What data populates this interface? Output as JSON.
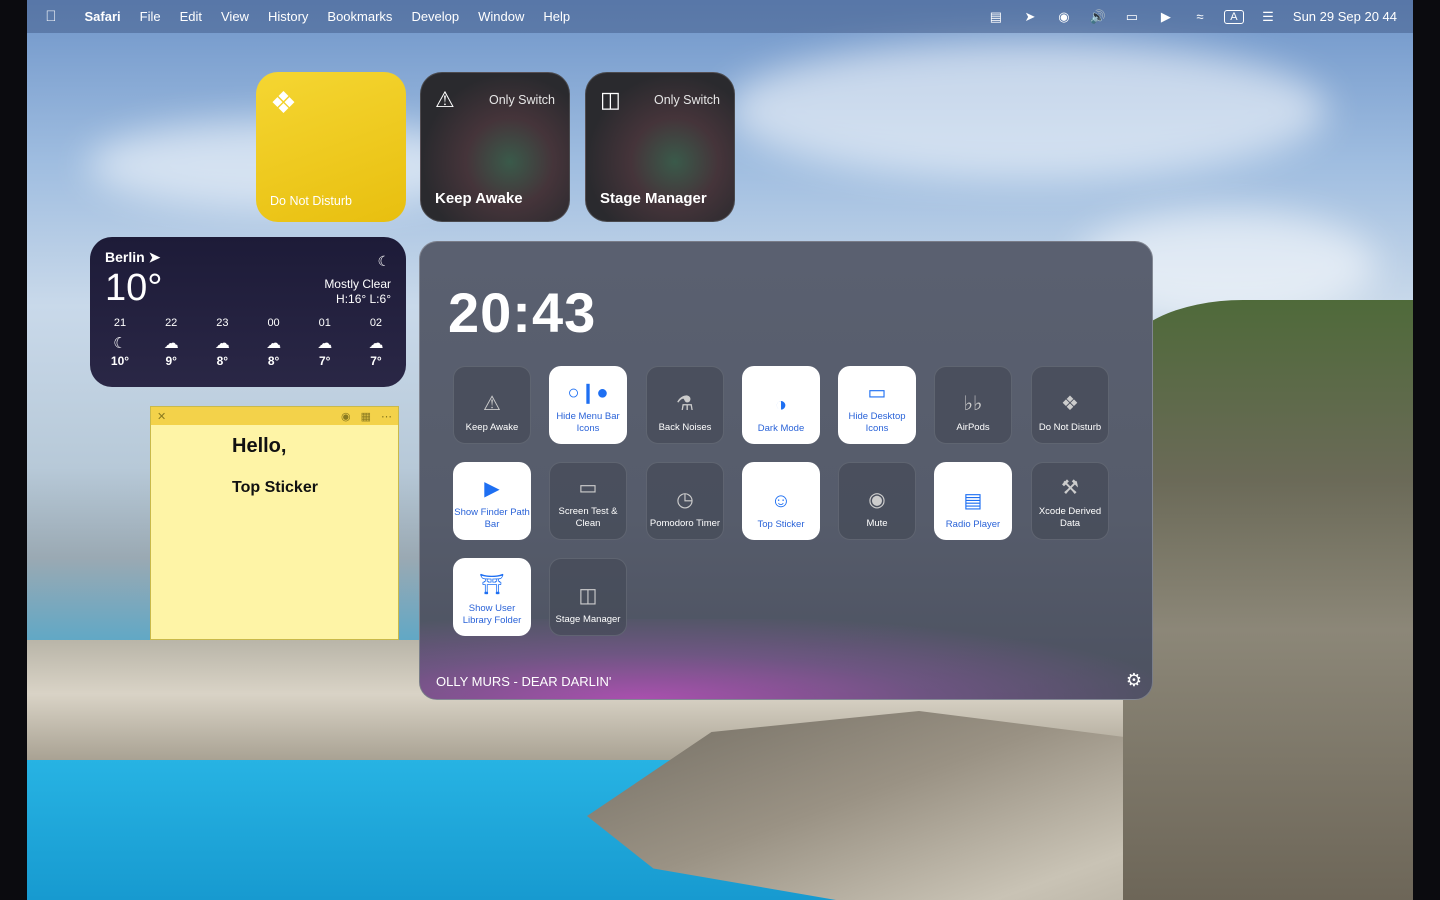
{
  "menubar": {
    "apple_icon": "apple-icon",
    "items": [
      "Safari",
      "File",
      "Edit",
      "View",
      "History",
      "Bookmarks",
      "Develop",
      "Window",
      "Help"
    ],
    "status_icons": [
      "control-strip-icon",
      "telegram-icon",
      "wechat-icon",
      "volume-icon",
      "battery-icon",
      "play-icon",
      "wifi-icon",
      "input-source-icon",
      "control-center-icon"
    ],
    "input_source": "A",
    "clock": "Sun 29 Sep  20 44"
  },
  "shortcuts": [
    {
      "label": "Do Not Disturb",
      "sub": "",
      "icon": "shortcuts-icon",
      "style": "yellow"
    },
    {
      "label": "Keep Awake",
      "sub": "Only Switch",
      "icon": "bell-slash-icon",
      "style": "dark"
    },
    {
      "label": "Stage Manager",
      "sub": "Only Switch",
      "icon": "stage-manager-icon",
      "style": "dark"
    }
  ],
  "weather": {
    "city": "Berlin",
    "temp": "10°",
    "condition": "Mostly Clear",
    "hilo": "H:16° L:6°",
    "hours": [
      {
        "time": "21",
        "icon": "moon-icon",
        "temp": "10°"
      },
      {
        "time": "22",
        "icon": "cloud-moon-icon",
        "temp": "9°"
      },
      {
        "time": "23",
        "icon": "cloud-moon-icon",
        "temp": "8°"
      },
      {
        "time": "00",
        "icon": "cloud-icon",
        "temp": "8°"
      },
      {
        "time": "01",
        "icon": "cloud-icon",
        "temp": "7°"
      },
      {
        "time": "02",
        "icon": "cloud-icon",
        "temp": "7°"
      }
    ]
  },
  "sticky": {
    "hello": "Hello,",
    "name": "Top Sticker"
  },
  "panel": {
    "time": "20:43",
    "song": "OLLY MURS - DEAR DARLIN'",
    "tiles": [
      {
        "label": "Keep Awake",
        "icon": "bell-slash-icon",
        "style": "dark"
      },
      {
        "label": "Hide Menu Bar Icons",
        "icon": "menu-bar-icon",
        "style": "light"
      },
      {
        "label": "Back Noises",
        "icon": "ear-icon",
        "style": "dark"
      },
      {
        "label": "Dark Mode",
        "icon": "dark-mode-icon",
        "style": "light"
      },
      {
        "label": "Hide Desktop Icons",
        "icon": "desktop-icon",
        "style": "light"
      },
      {
        "label": "AirPods",
        "icon": "airpods-icon",
        "style": "dark"
      },
      {
        "label": "Do Not Disturb",
        "icon": "shortcuts-icon",
        "style": "dark"
      },
      {
        "label": "Show Finder Path Bar",
        "icon": "terminal-icon",
        "style": "light"
      },
      {
        "label": "Screen Test & Clean",
        "icon": "screen-test-icon",
        "style": "dark"
      },
      {
        "label": "Pomodoro Timer",
        "icon": "timer-icon",
        "style": "dark"
      },
      {
        "label": "Top Sticker",
        "icon": "sticker-icon",
        "style": "light"
      },
      {
        "label": "Mute",
        "icon": "mute-icon",
        "style": "dark"
      },
      {
        "label": "Radio Player",
        "icon": "radio-icon",
        "style": "light"
      },
      {
        "label": "Xcode Derived Data",
        "icon": "xcode-icon",
        "style": "dark"
      },
      {
        "label": "Show User Library Folder",
        "icon": "library-icon",
        "style": "light"
      },
      {
        "label": "Stage Manager",
        "icon": "stage-manager-icon",
        "style": "dark"
      }
    ]
  }
}
